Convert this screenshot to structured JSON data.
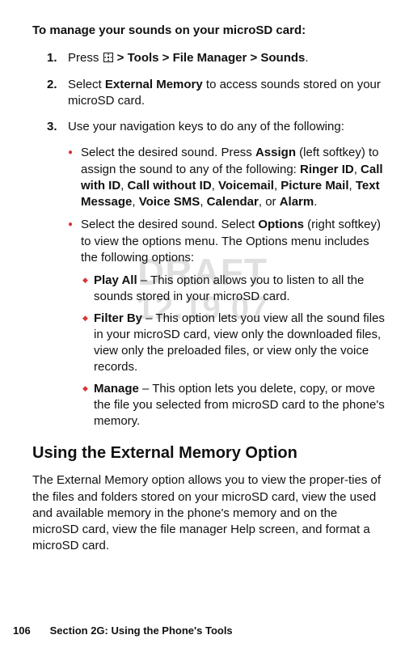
{
  "watermark": {
    "line1": "DRAFT",
    "line2": "12.19.07"
  },
  "intro": "To manage your sounds on your microSD card:",
  "steps": {
    "s1": {
      "num": "1.",
      "lead": "Press ",
      "trail": " > Tools > File Manager > Sounds",
      "end": "."
    },
    "s2": {
      "num": "2.",
      "lead": "Select ",
      "bold": "External Memory",
      "trail": " to access sounds stored on your microSD card."
    },
    "s3": {
      "num": "3.",
      "text": "Use your navigation keys to do any of the following:"
    }
  },
  "l1": {
    "a": {
      "pre": "Select the desired sound. Press ",
      "assign": "Assign",
      "mid": " (left softkey) to assign the sound to any of the following: ",
      "items": [
        "Ringer ID",
        "Call with ID",
        "Call without ID",
        "Voicemail",
        "Picture Mail",
        "Text Message",
        "Voice SMS",
        "Calendar"
      ],
      "or": ", or ",
      "last": "Alarm",
      "end": "."
    },
    "b": {
      "pre": "Select the desired sound. Select ",
      "options": "Options",
      "trail": " (right softkey) to view the options menu. The Options menu includes the following options:"
    }
  },
  "l2": {
    "play": {
      "label": "Play All",
      "text": " – This option allows you to listen to all the sounds stored in your microSD card."
    },
    "filter": {
      "label": "Filter By",
      "text": " – This option lets you view all the sound files in your microSD card, view only the downloaded files, view only the preloaded files, or view only the voice records."
    },
    "manage": {
      "label": "Manage",
      "text": " – This option lets you delete, copy, or move the file you selected from microSD card to the phone's memory."
    }
  },
  "heading": "Using the External Memory Option",
  "body": "The External Memory option allows you to view the proper-ties of the files and folders stored on your microSD card, view the used and available memory in the phone's memory and on the microSD card, view the file manager Help screen, and format a microSD card.",
  "footer": {
    "page": "106",
    "section": "Section 2G: Using the Phone's Tools"
  },
  "sep": ", "
}
